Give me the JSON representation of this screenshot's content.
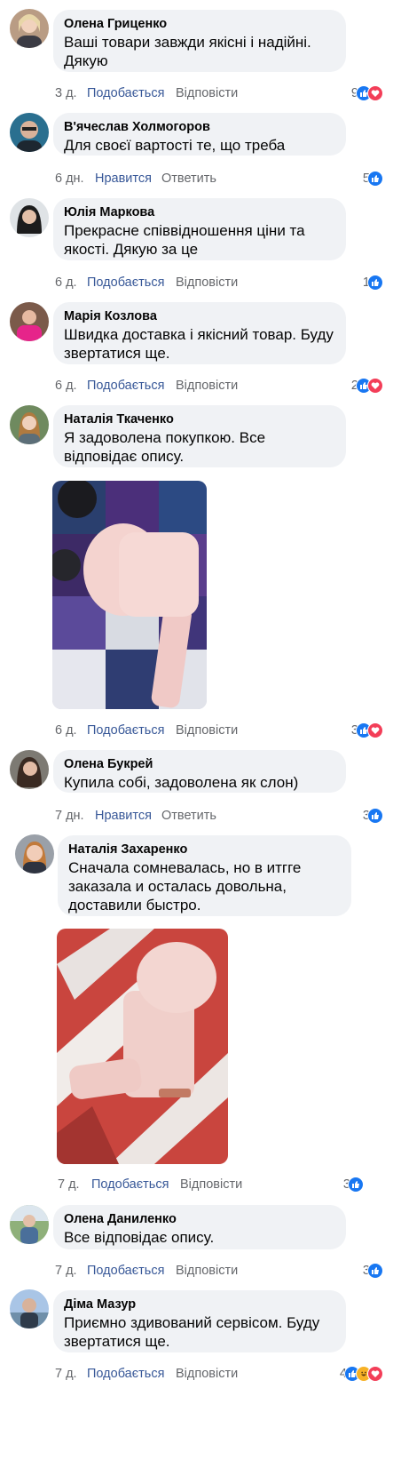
{
  "comments": [
    {
      "author": "Олена Гриценко",
      "text_lines": [
        "Ваші товари завжди якісні і надійні.",
        "Дякую"
      ],
      "time": "3 д.",
      "like_label": "Подобається",
      "reply_label": "Відповісти",
      "count": "9",
      "reactions": [
        "like-icon",
        "love-icon"
      ]
    },
    {
      "author": "В'ячеслав Холмогоров",
      "text_lines": [
        "Для своєї вартості те, що треба"
      ],
      "time": "6 дн.",
      "like_label": "Нравится",
      "reply_label": "Ответить",
      "count": "5",
      "reactions": [
        "like-icon"
      ]
    },
    {
      "author": "Юлія Маркова",
      "text_lines": [
        "Прекрасне співвідношення ціни та",
        "якості. Дякую за це"
      ],
      "time": "6 д.",
      "like_label": "Подобається",
      "reply_label": "Відповісти",
      "count": "1",
      "reactions": [
        "like-icon"
      ]
    },
    {
      "author": "Марія Козлова",
      "text_lines": [
        "Швидка доставка і якісний товар. Буду",
        "звертатися ще."
      ],
      "time": "6 д.",
      "like_label": "Подобається",
      "reply_label": "Відповісти",
      "count": "2",
      "reactions": [
        "like-icon",
        "love-icon"
      ]
    },
    {
      "author": "Наталія Ткаченко",
      "text_lines": [
        "Я задоволена покупкою. Все",
        "відповідає опису."
      ],
      "time": "6 д.",
      "like_label": "Подобається",
      "reply_label": "Відповісти",
      "count": "3",
      "reactions": [
        "like-icon",
        "love-icon"
      ]
    },
    {
      "author": "Олена Букрей",
      "text_lines": [
        "Купила собі, задоволена як слон)"
      ],
      "time": "7 дн.",
      "like_label": "Нравится",
      "reply_label": "Ответить",
      "count": "3",
      "reactions": [
        "like-icon"
      ]
    },
    {
      "author": "Наталія Захаренко",
      "text_lines": [
        "Сначала сомневалась, но в итгге",
        "заказала и осталась довольна,",
        "доставили быстро."
      ],
      "time": "7 д.",
      "like_label": "Подобається",
      "reply_label": "Відповісти",
      "count": "3",
      "reactions": [
        "like-icon"
      ]
    },
    {
      "author": "Олена Даниленко",
      "text_lines": [
        "Все відповідає опису."
      ],
      "time": "7 д.",
      "like_label": "Подобається",
      "reply_label": "Відповісти",
      "count": "3",
      "reactions": [
        "like-icon"
      ]
    },
    {
      "author": "Діма Мазур",
      "text_lines": [
        "Приємно здивований сервісом. Буду",
        "звертатися ще."
      ],
      "time": "7 д.",
      "like_label": "Подобається",
      "reply_label": "Відповісти",
      "count": "4",
      "reactions": [
        "like-icon",
        "haha-icon",
        "love-icon"
      ]
    }
  ],
  "colors": {
    "bubble": "#f0f2f5",
    "like_link": "#385898",
    "meta": "#65676b",
    "like_reaction": "#1877f2",
    "love_reaction": "#f33e58",
    "haha_reaction": "#f7b125"
  }
}
